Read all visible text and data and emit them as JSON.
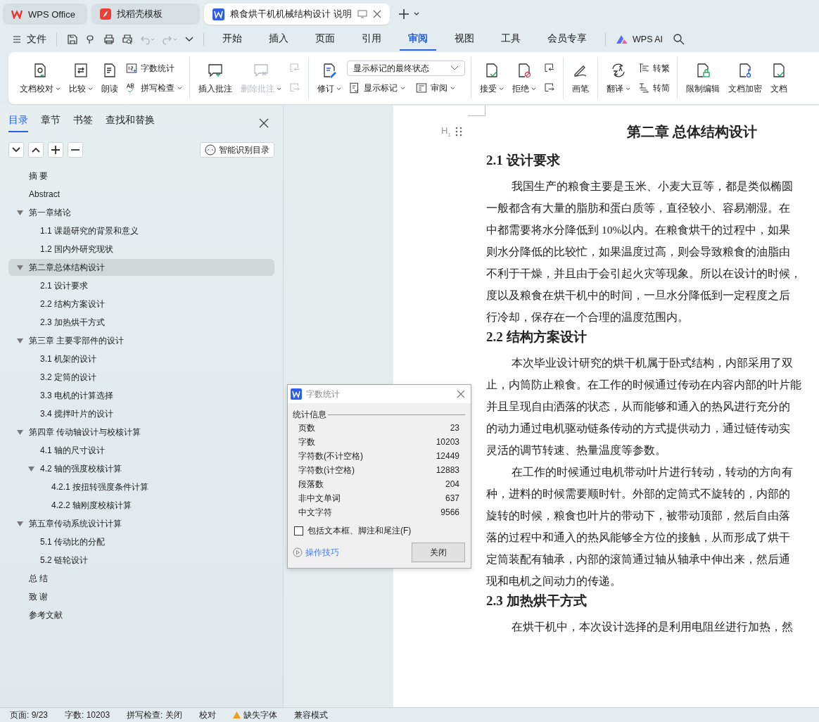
{
  "browser_tabs": [
    {
      "label": "WPS Office",
      "kind": "wps",
      "selected": false
    },
    {
      "label": "找稻壳模板",
      "kind": "docer",
      "selected": false
    },
    {
      "label": "粮食烘干机机械结构设计 说明",
      "kind": "doc",
      "selected": true
    }
  ],
  "menu": {
    "file": "文件",
    "tabs": [
      {
        "label": "开始",
        "selected": false
      },
      {
        "label": "插入",
        "selected": false
      },
      {
        "label": "页面",
        "selected": false
      },
      {
        "label": "引用",
        "selected": false
      },
      {
        "label": "审阅",
        "selected": true
      },
      {
        "label": "视图",
        "selected": false
      },
      {
        "label": "工具",
        "selected": false
      },
      {
        "label": "会员专享",
        "selected": false
      }
    ],
    "ai": "WPS AI"
  },
  "ribbon": [
    {
      "items": [
        {
          "kind": "large",
          "label": "文档校对",
          "caret": true,
          "disabled": false
        },
        {
          "kind": "large",
          "label": "比较",
          "caret": true,
          "disabled": false
        },
        {
          "kind": "large",
          "label": "朗读",
          "caret": false,
          "disabled": false
        },
        {
          "kind": "stack",
          "children": [
            {
              "label": "字数统计",
              "caret": false,
              "disabled": false
            },
            {
              "label": "拼写检查",
              "caret": true,
              "disabled": false
            }
          ]
        }
      ]
    },
    {
      "items": [
        {
          "kind": "large",
          "label": "插入批注",
          "caret": false,
          "disabled": false
        },
        {
          "kind": "large",
          "label": "删除批注",
          "caret": true,
          "disabled": true
        },
        {
          "kind": "stack",
          "children": [
            {
              "caret": false,
              "disabled": true
            },
            {
              "caret": false,
              "disabled": true
            }
          ]
        }
      ]
    },
    {
      "items": [
        {
          "kind": "large",
          "label": "修订",
          "caret": true,
          "disabled": false
        },
        {
          "kind": "select",
          "value": "显示标记的最终状态",
          "children": [
            {
              "label": "显示标记",
              "caret": true,
              "disabled": false
            },
            {
              "label": "审阅",
              "caret": true,
              "disabled": false
            }
          ]
        }
      ]
    },
    {
      "items": [
        {
          "kind": "large",
          "label": "接受",
          "caret": true,
          "disabled": false
        },
        {
          "kind": "large",
          "label": "拒绝",
          "caret": true,
          "disabled": false
        },
        {
          "kind": "stack",
          "children": [
            {
              "caret": false,
              "disabled": false
            },
            {
              "caret": false,
              "disabled": false
            }
          ]
        }
      ]
    },
    {
      "items": [
        {
          "kind": "large",
          "label": "画笔",
          "caret": false,
          "disabled": false
        }
      ]
    },
    {
      "items": [
        {
          "kind": "large",
          "label": "翻译",
          "caret": true,
          "disabled": false
        },
        {
          "kind": "stack",
          "children": [
            {
              "label": "转繁",
              "caret": false,
              "disabled": false
            },
            {
              "label": "转简",
              "caret": false,
              "disabled": false
            }
          ]
        }
      ]
    },
    {
      "items": [
        {
          "kind": "large",
          "label": "限制编辑",
          "caret": false,
          "disabled": false
        },
        {
          "kind": "large",
          "label": "文档加密",
          "caret": false,
          "disabled": false
        },
        {
          "kind": "large",
          "label": "文档",
          "caret": false,
          "disabled": false
        }
      ]
    }
  ],
  "sidebar": {
    "tabs": [
      {
        "label": "目录",
        "selected": true
      },
      {
        "label": "章节",
        "selected": false
      },
      {
        "label": "书签",
        "selected": false
      },
      {
        "label": "查找和替换",
        "selected": false
      }
    ],
    "smart_button": "智能识别目录",
    "toc": [
      {
        "label": "摘 要",
        "selected": false
      },
      {
        "label": "Abstract",
        "selected": false
      },
      {
        "label": "第一章绪论",
        "selected": false,
        "expanded": true,
        "children": [
          {
            "label": "1.1  课题研究的背景和意义",
            "selected": false
          },
          {
            "label": "1.2  国内外研究现状",
            "selected": false
          }
        ]
      },
      {
        "label": "第二章总体结构设计",
        "selected": true,
        "expanded": true,
        "children": [
          {
            "label": "2.1  设计要求",
            "selected": false
          },
          {
            "label": "2.2  结构方案设计",
            "selected": false
          },
          {
            "label": "2.3  加热烘干方式",
            "selected": false
          }
        ]
      },
      {
        "label": "第三章  主要零部件的设计",
        "selected": false,
        "expanded": true,
        "children": [
          {
            "label": "3.1  机架的设计",
            "selected": false
          },
          {
            "label": "3.2  定筒的设计",
            "selected": false
          },
          {
            "label": "3.3 电机的计算选择",
            "selected": false
          },
          {
            "label": "3.4  搅拌叶片的设计",
            "selected": false
          }
        ]
      },
      {
        "label": "第四章  传动轴设计与校核计算",
        "selected": false,
        "expanded": true,
        "children": [
          {
            "label": "4.1  轴的尺寸设计",
            "selected": false
          },
          {
            "label": "4.2  轴的强度校核计算",
            "selected": false,
            "expanded": true,
            "children": [
              {
                "label": "4.2.1  按扭转强度条件计算",
                "selected": false
              },
              {
                "label": "4.2.2 轴刚度校核计算",
                "selected": false
              }
            ]
          }
        ]
      },
      {
        "label": "第五章传动系统设计计算",
        "selected": false,
        "expanded": true,
        "children": [
          {
            "label": "5.1  传动比的分配",
            "selected": false
          },
          {
            "label": "5.2  链轮设计",
            "selected": false
          }
        ]
      },
      {
        "label": "总 结",
        "selected": false
      },
      {
        "label": "致 谢",
        "selected": false
      },
      {
        "label": "参考文献",
        "selected": false
      }
    ]
  },
  "document": {
    "heading_marker": "H$_{1}$",
    "title": "第二章  总体结构设计",
    "sections": [
      {
        "heading": "2.1  设计要求",
        "paragraphs": [
          [
            "我国生产的粮食主要是玉米、小麦大豆等，都是类似椭圆",
            "一般都含有大量的脂肪和蛋白质等，直径较小、容易潮湿。在",
            "中都需要将水分降低到 10%以内。在粮食烘干的过程中，如果",
            "则水分降低的比较忙，如果温度过高，则会导致粮食的油脂由",
            "不利于干燥，并且由于会引起火灾等现象。所以在设计的时候，",
            "度以及粮食在烘干机中的时间，一旦水分降低到一定程度之后",
            "行冷却，保存在一个合理的温度范围内。"
          ]
        ]
      },
      {
        "heading": "2.2  结构方案设计",
        "paragraphs": [
          [
            "本次毕业设计研究的烘干机属于卧式结构，内部采用了双",
            "止，内筒防止粮食。在工作的时候通过传动在内容内部的叶片能",
            "并且呈现自由洒落的状态，从而能够和通入的热风进行充分的",
            "的动力通过电机驱动链条传动的方式提供动力，通过链传动实",
            "灵活的调节转速、热量温度等参数。"
          ],
          [
            "在工作的时候通过电机带动叶片进行转动，转动的方向有",
            "种，进料的时候需要顺时针。外部的定筒式不旋转的，内部的",
            "旋转的时候，粮食也叶片的带动下，被带动顶部，然后自由落",
            "落的过程中和通入的热风能够全方位的接触，从而形成了烘干",
            "定筒装配有轴承，内部的滚筒通过轴从轴承中伸出来，然后通",
            "现和电机之间动力的传递。"
          ]
        ]
      },
      {
        "heading": "2.3  加热烘干方式",
        "paragraphs": [
          [
            "在烘干机中，本次设计选择的是利用电阻丝进行加热，然"
          ]
        ]
      }
    ]
  },
  "dialog": {
    "title": "字数统计",
    "section": "统计信息",
    "rows": [
      {
        "label": "页数",
        "value": "23"
      },
      {
        "label": "字数",
        "value": "10203"
      },
      {
        "label": "字符数(不计空格)",
        "value": "12449"
      },
      {
        "label": "字符数(计空格)",
        "value": "12883"
      },
      {
        "label": "段落数",
        "value": "204"
      },
      {
        "label": "非中文单词",
        "value": "637"
      },
      {
        "label": "中文字符",
        "value": "9566"
      }
    ],
    "checkbox": {
      "label": "包括文本框、脚注和尾注(F)",
      "checked": false
    },
    "tips": "操作技巧",
    "close": "关闭"
  },
  "status_bar": [
    {
      "label": "页面: 9/23",
      "kind": "text"
    },
    {
      "label": "字数: 10203",
      "kind": "text"
    },
    {
      "label": "拼写检查: 关闭",
      "kind": "text"
    },
    {
      "label": "校对",
      "kind": "text"
    },
    {
      "label": "缺失字体",
      "kind": "warning"
    },
    {
      "label": "兼容模式",
      "kind": "text"
    }
  ]
}
